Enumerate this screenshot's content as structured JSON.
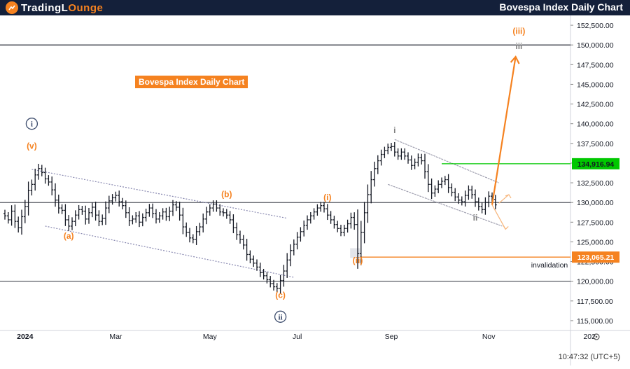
{
  "header": {
    "logo_text_1": "TradingL",
    "logo_text_2": "O",
    "logo_text_3": "unge",
    "title": "Bovespa Index Daily Chart"
  },
  "chart_tag": "Bovespa Index Daily Chart",
  "status_time": "10:47:32 (UTC+5)",
  "colors": {
    "bar": "#131722",
    "orange": "#f58220",
    "green": "#00c800",
    "navy": "#3a4a6b",
    "gray": "#808080",
    "channel": "#8888b0"
  },
  "chart_data": {
    "type": "ohlc",
    "y_axis": {
      "min": 113750,
      "max": 153750,
      "ticks": [
        "152,500.00",
        "150,000.00",
        "147,500.00",
        "145,000.00",
        "142,500.00",
        "140,000.00",
        "137,500.00",
        "135,000.00",
        "132,500.00",
        "130,000.00",
        "127,500.00",
        "125,000.00",
        "122,500.00",
        "120,000.00",
        "117,500.00",
        "115,000.00"
      ],
      "tick_values": [
        152500,
        150000,
        147500,
        145000,
        142500,
        140000,
        137500,
        135000,
        132500,
        130000,
        127500,
        125000,
        122500,
        120000,
        117500,
        115000
      ]
    },
    "x_axis": {
      "labels": [
        "2024",
        "Mar",
        "May",
        "Jul",
        "Sep",
        "Nov",
        "202"
      ],
      "label_sessions": [
        6,
        33,
        61,
        87,
        115,
        144,
        174
      ]
    },
    "horizontal_lines": [
      150000,
      130000,
      120000
    ],
    "price_labels": [
      {
        "value": 134916.94,
        "text": "134,916.94",
        "color": "#00c800"
      },
      {
        "value": 123065.21,
        "text": "123,065.21",
        "color": "#f58220"
      }
    ],
    "invalidation_label": "invalidation",
    "wave_labels": [
      {
        "text": "i",
        "style": "circle-navy",
        "session": 8,
        "value": 140000
      },
      {
        "text": "(v)",
        "style": "orange",
        "session": 8,
        "value": 136800
      },
      {
        "text": "(a)",
        "style": "orange",
        "session": 19,
        "value": 125400
      },
      {
        "text": "(b)",
        "style": "orange",
        "session": 66,
        "value": 130700
      },
      {
        "text": "(c)",
        "style": "orange",
        "session": 82,
        "value": 117900
      },
      {
        "text": "ii",
        "style": "circle-navy",
        "session": 82,
        "value": 115500
      },
      {
        "text": "(i)",
        "style": "orange",
        "session": 96,
        "value": 130300
      },
      {
        "text": "(ii)",
        "style": "orange",
        "session": 105,
        "value": 122300
      },
      {
        "text": "i",
        "style": "gray",
        "session": 116,
        "value": 138800
      },
      {
        "text": "ii",
        "style": "gray",
        "session": 140,
        "value": 127700
      },
      {
        "text": "(iii)",
        "style": "orange",
        "session": 153,
        "value": 151400
      },
      {
        "text": "iii",
        "style": "gray",
        "session": 153,
        "value": 149500
      }
    ],
    "closes": [
      128300,
      127800,
      128900,
      127600,
      126800,
      128200,
      129500,
      131500,
      132300,
      133500,
      134300,
      133800,
      133000,
      132600,
      131600,
      130300,
      129300,
      129000,
      127800,
      127000,
      127600,
      128400,
      129100,
      128900,
      127900,
      128700,
      129400,
      128400,
      127600,
      128000,
      129300,
      130200,
      130600,
      130900,
      130100,
      129600,
      128700,
      127700,
      127900,
      128300,
      127500,
      128100,
      128700,
      129300,
      128600,
      127900,
      128300,
      128800,
      128200,
      128900,
      129700,
      129400,
      128400,
      126900,
      126200,
      125500,
      125300,
      126300,
      126900,
      127900,
      128800,
      129300,
      129800,
      129300,
      128800,
      128700,
      128400,
      127800,
      126800,
      125900,
      125300,
      124600,
      123400,
      122800,
      122300,
      121800,
      121100,
      120700,
      120200,
      119700,
      119300,
      119100,
      120100,
      121300,
      122700,
      123900,
      124700,
      125600,
      126300,
      127100,
      127800,
      128300,
      128800,
      129300,
      129600,
      129200,
      128400,
      127800,
      127200,
      126700,
      126200,
      126700,
      127300,
      128100,
      127200,
      123500,
      126200,
      128700,
      131000,
      132900,
      134300,
      135300,
      136100,
      136600,
      137000,
      137100,
      136400,
      135900,
      136400,
      135900,
      135400,
      134700,
      135100,
      135700,
      135300,
      133900,
      132300,
      131200,
      131700,
      132300,
      132700,
      132900,
      131900,
      131300,
      130700,
      130300,
      130100,
      130900,
      131600,
      131000,
      130100,
      129500,
      129100,
      130000,
      130800,
      130400,
      129700
    ],
    "channels": [
      {
        "from": [
          8,
          134200
        ],
        "to": [
          84,
          128000
        ],
        "style": "dotted"
      },
      {
        "from": [
          12,
          127000
        ],
        "to": [
          86,
          120500
        ],
        "style": "dotted"
      },
      {
        "from": [
          116,
          138000
        ],
        "to": [
          147,
          132500
        ],
        "style": "solid"
      },
      {
        "from": [
          114,
          132300
        ],
        "to": [
          148,
          127000
        ],
        "style": "solid"
      }
    ],
    "projection": {
      "from": [
        145,
        129700
      ],
      "to": [
        152,
        148500
      ],
      "color": "#f58220"
    },
    "alt_projection_up": {
      "from": [
        147,
        129900
      ],
      "to": [
        150,
        131000
      ]
    },
    "alt_projection_down": {
      "from": [
        145,
        129700
      ],
      "to": [
        149,
        126600
      ]
    },
    "green_line": {
      "from_session": 130,
      "value": 134916.94
    },
    "orange_line": {
      "from_session": 105,
      "value": 123065.21
    }
  }
}
